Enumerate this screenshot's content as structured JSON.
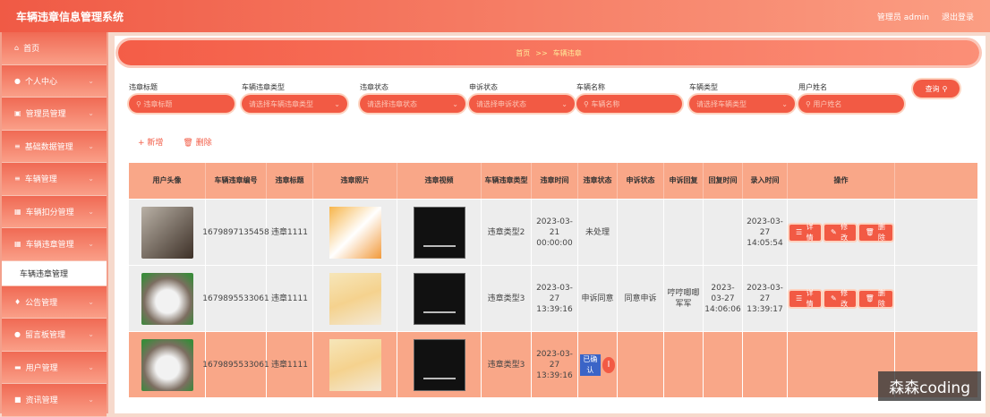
{
  "header": {
    "title": "车辆违章信息管理系统",
    "admin": "管理员 admin",
    "logout": "退出登录"
  },
  "sidebar": {
    "items": [
      {
        "label": "首页",
        "icon": "home-icon",
        "glyph": "⌂",
        "sub": false,
        "chev": false
      },
      {
        "label": "个人中心",
        "icon": "user-icon",
        "glyph": "●",
        "sub": false,
        "chev": true
      },
      {
        "label": "管理员管理",
        "icon": "admin-icon",
        "glyph": "▣",
        "sub": false,
        "chev": true
      },
      {
        "label": "基础数据管理",
        "icon": "list-icon",
        "glyph": "≡",
        "sub": false,
        "chev": true
      },
      {
        "label": "车辆管理",
        "icon": "list-icon",
        "glyph": "≡",
        "sub": false,
        "chev": true
      },
      {
        "label": "车辆扣分管理",
        "icon": "grid-icon",
        "glyph": "▦",
        "sub": false,
        "chev": true
      },
      {
        "label": "车辆违章管理",
        "icon": "grid-icon",
        "glyph": "▦",
        "sub": false,
        "chev": true
      },
      {
        "label": "车辆违章管理",
        "icon": "",
        "glyph": "",
        "sub": true,
        "chev": false
      },
      {
        "label": "公告管理",
        "icon": "notice-icon",
        "glyph": "♦",
        "sub": false,
        "chev": true
      },
      {
        "label": "留言板管理",
        "icon": "user-icon",
        "glyph": "●",
        "sub": false,
        "chev": true
      },
      {
        "label": "用户管理",
        "icon": "folder-icon",
        "glyph": "▬",
        "sub": false,
        "chev": true
      },
      {
        "label": "资讯管理",
        "icon": "news-icon",
        "glyph": "■",
        "sub": false,
        "chev": true
      }
    ]
  },
  "breadcrumb": {
    "home": "首页",
    "sep": ">>",
    "current": "车辆违章"
  },
  "filters": [
    {
      "label": "违章标题",
      "placeholder": "违章标题",
      "select": false
    },
    {
      "label": "车辆违章类型",
      "placeholder": "请选择车辆违章类型",
      "select": true
    },
    {
      "label": "违章状态",
      "placeholder": "请选择违章状态",
      "select": true
    },
    {
      "label": "申诉状态",
      "placeholder": "请选择申诉状态",
      "select": true
    },
    {
      "label": "车辆名称",
      "placeholder": "车辆名称",
      "select": false
    },
    {
      "label": "车辆类型",
      "placeholder": "请选择车辆类型",
      "select": true
    },
    {
      "label": "用户姓名",
      "placeholder": "用户姓名",
      "select": false
    }
  ],
  "query_label": "查询",
  "add_label": "+ 新增",
  "delete_label": "删除",
  "table": {
    "headers": [
      "用户头像",
      "车辆违章编号",
      "违章标题",
      "违章照片",
      "违章视频",
      "车辆违章类型",
      "违章时间",
      "违章状态",
      "申诉状态",
      "申诉回复",
      "回复时间",
      "录入时间",
      "操作"
    ],
    "rows": [
      {
        "number": "1679897135458",
        "title": "违章1111",
        "type": "违章类型2",
        "time": "2023-03-21 00:00:00",
        "status": "未处理",
        "appeal": "",
        "reply": "",
        "reply_time": "",
        "entry_time": "2023-03-27 14:05:54"
      },
      {
        "number": "1679895533061",
        "title": "违章1111",
        "type": "违章类型3",
        "time": "2023-03-27 13:39:16",
        "status": "申诉同意",
        "appeal": "同意申诉",
        "reply": "哼哼唧唧军军",
        "reply_time": "2023-03-27 14:06:06",
        "entry_time": "2023-03-27 13:39:17"
      },
      {
        "number": "1679895533061",
        "title": "违章1111",
        "type": "违章类型3",
        "time": "2023-03-27 13:39:16",
        "status": "已确认",
        "appeal": "",
        "reply": "",
        "reply_time": "",
        "entry_time": ""
      }
    ]
  },
  "op_labels": {
    "detail": "详情",
    "edit": "修改",
    "delete": "删除"
  },
  "watermark": "森森coding"
}
